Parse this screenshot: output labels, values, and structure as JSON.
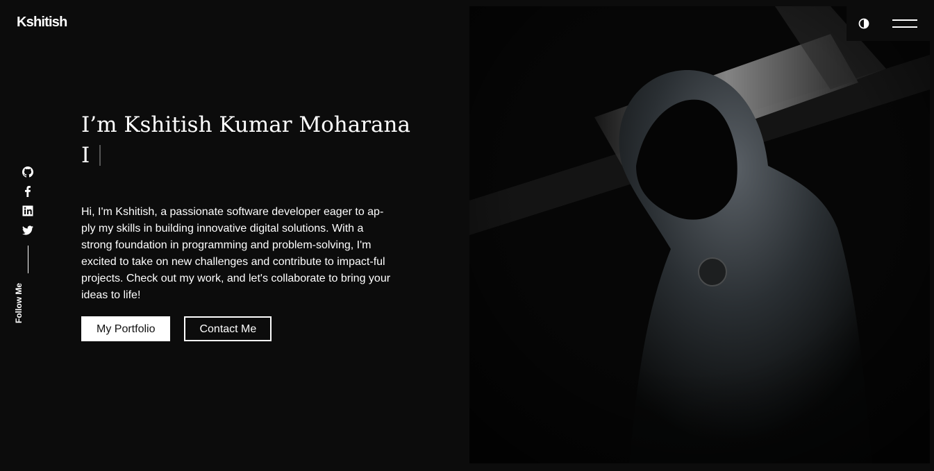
{
  "brand": {
    "logo": "Kshitish"
  },
  "social": {
    "icons": [
      "github-icon",
      "facebook-icon",
      "linkedin-icon",
      "twitter-icon"
    ],
    "follow_label": "Follow Me"
  },
  "hero": {
    "title": "I’m Kshitish Kumar Moharana",
    "typed_text": "I",
    "intro": "Hi, I'm Kshitish, a passionate software developer eager to ap-ply my skills in building innovative digital solutions. With a strong foundation in programming and problem-solving, I'm excited to take on new challenges and contribute to impact-ful projects. Check out my work, and let's collaborate to bring your ideas to life!",
    "portfolio_button": "My Portfolio",
    "contact_button": "Contact Me"
  },
  "topbar": {
    "theme_icon": "contrast-icon",
    "menu_icon": "hamburger-menu-icon"
  },
  "colors": {
    "background": "#0c0c0c",
    "text": "#ffffff",
    "accent": "#ffffff"
  }
}
